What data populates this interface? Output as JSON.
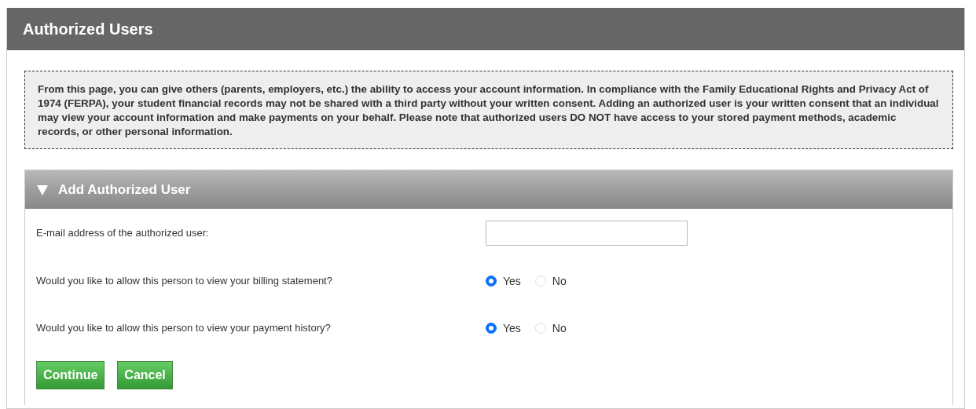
{
  "panel": {
    "title": "Authorized Users"
  },
  "notice": "From this page, you can give others (parents, employers, etc.) the ability to access your account information. In compliance with the Family Educational Rights and Privacy Act of 1974 (FERPA), your student financial records may not be shared with a third party without your written consent. Adding an authorized user is your written consent that an individual may view your account information and make payments on your behalf. Please note that authorized users DO NOT have access to your stored payment methods, academic records, or other personal information.",
  "section": {
    "title": "Add Authorized User",
    "expanded": true,
    "fields": [
      {
        "kind": "text",
        "label": "E-mail address of the authorized user:"
      },
      {
        "kind": "radio",
        "label": "Would you like to allow this person to view your billing statement?",
        "options": [
          {
            "label": "Yes",
            "selected": true
          },
          {
            "label": "No",
            "selected": false
          }
        ]
      },
      {
        "kind": "radio",
        "label": "Would you like to allow this person to view your payment history?",
        "options": [
          {
            "label": "Yes",
            "selected": true
          },
          {
            "label": "No",
            "selected": false
          }
        ]
      }
    ],
    "buttons": [
      "Continue",
      "Cancel"
    ]
  }
}
